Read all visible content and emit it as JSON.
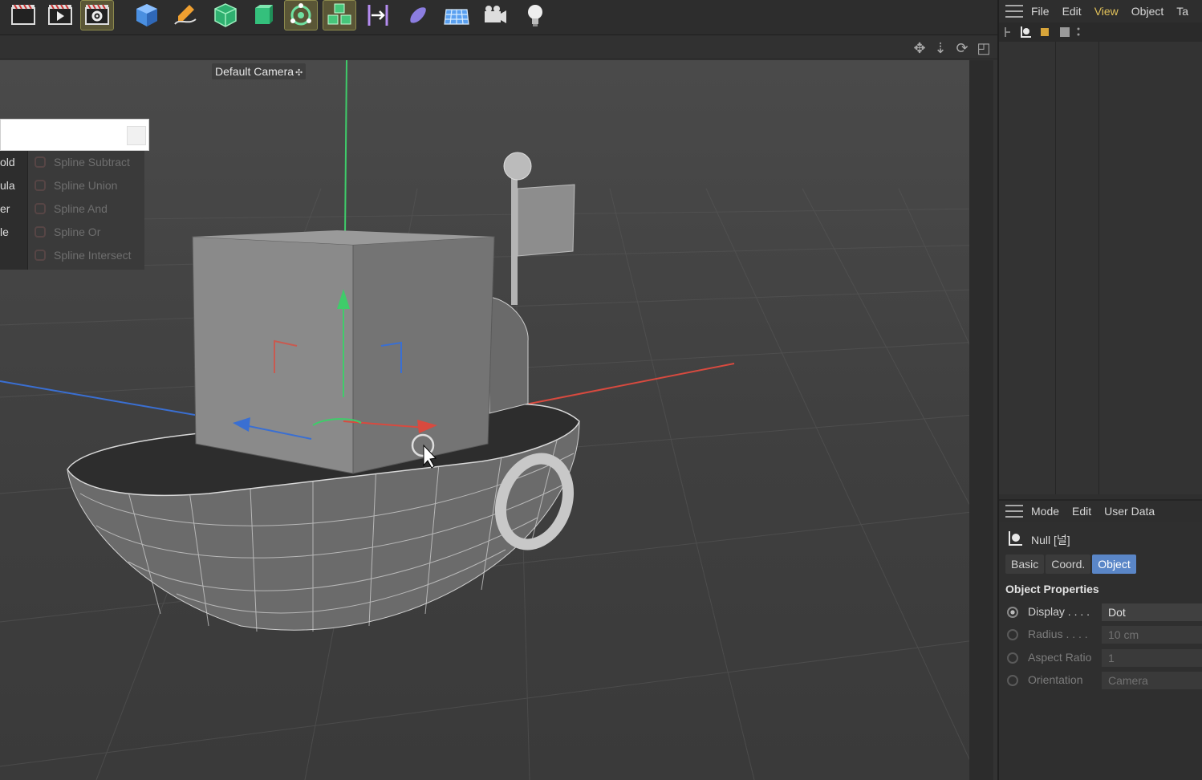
{
  "toolbar": {
    "buttons": [
      {
        "icon": "render-view-icon"
      },
      {
        "icon": "render-picture-viewer-icon"
      },
      {
        "icon": "render-settings-icon"
      },
      {
        "icon": "cube-icon"
      },
      {
        "icon": "pen-spline-icon"
      },
      {
        "icon": "subdivision-surface-icon"
      },
      {
        "icon": "extrude-icon"
      },
      {
        "icon": "mograph-cloner-icon"
      },
      {
        "icon": "cube-array-icon"
      },
      {
        "icon": "deformer-icon"
      },
      {
        "icon": "sweep-icon"
      },
      {
        "icon": "floor-icon"
      },
      {
        "icon": "camera-icon"
      },
      {
        "icon": "light-icon"
      }
    ]
  },
  "viewport": {
    "camera_label": "Default Camera",
    "camera_icon": "camera-small-icon"
  },
  "spline_popup": {
    "left_items": [
      "old",
      "ula",
      "er",
      "le"
    ],
    "items": [
      "Spline Subtract",
      "Spline Union",
      "Spline And",
      "Spline Or",
      "Spline Intersect"
    ]
  },
  "object_manager": {
    "menu": [
      "File",
      "Edit",
      "View",
      "Object",
      "Ta"
    ],
    "highlight_index": 2
  },
  "attributes": {
    "menu": [
      "Mode",
      "Edit",
      "User Data"
    ],
    "object_title": "Null [널]",
    "tabs": [
      "Basic",
      "Coord.",
      "Object"
    ],
    "active_tab": "Object",
    "section_title": "Object Properties",
    "properties": [
      {
        "label": "Display . . . .",
        "value": "Dot",
        "enabled": true
      },
      {
        "label": "Radius . . . .",
        "value": "10 cm",
        "enabled": false
      },
      {
        "label": "Aspect Ratio",
        "value": "1",
        "enabled": false
      },
      {
        "label": "Orientation",
        "value": "Camera",
        "enabled": false
      }
    ]
  },
  "colors": {
    "accent_blue": "#5a86c7",
    "menu_highlight": "#e2c25a",
    "axis_x": "#d84a3f",
    "axis_y": "#3fcc6a",
    "axis_z": "#3a6fd2"
  }
}
